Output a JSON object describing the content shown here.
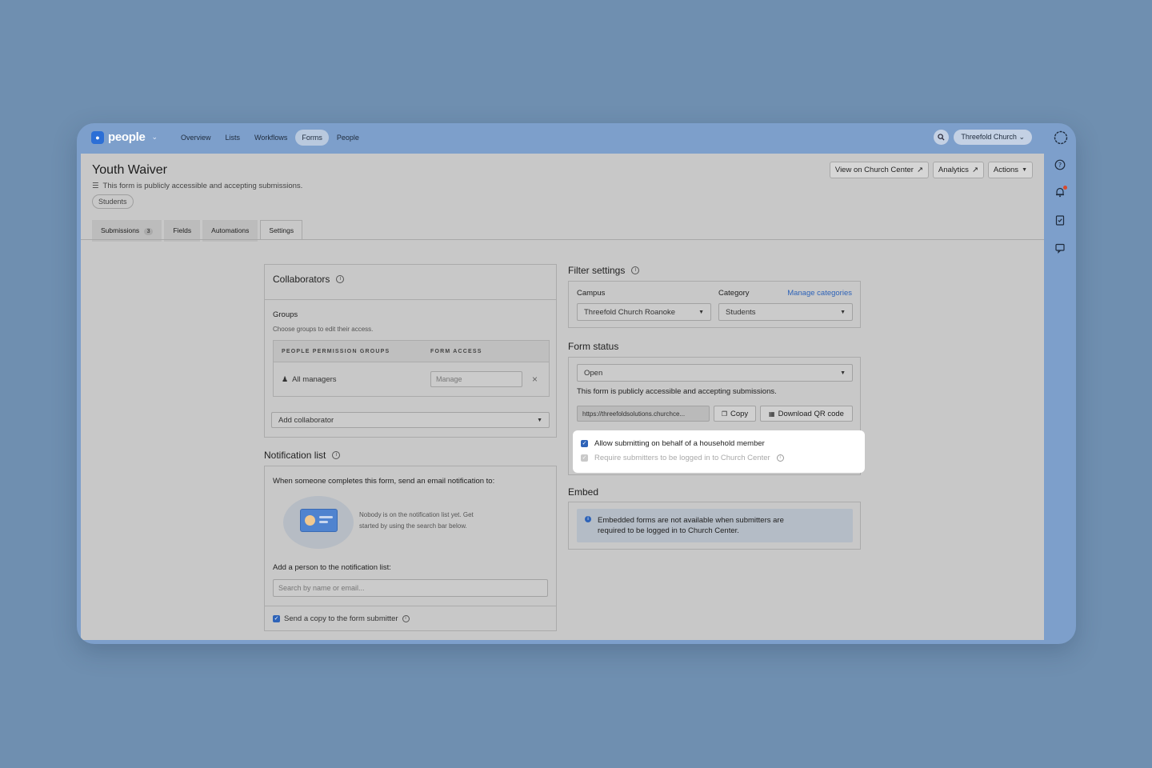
{
  "app": {
    "name": "people"
  },
  "nav": [
    "Overview",
    "Lists",
    "Workflows",
    "Forms",
    "People"
  ],
  "org_button": "Threefold Church",
  "page": {
    "title": "Youth Waiver",
    "subtitle": "This form is publicly accessible and accepting submissions.",
    "tag": "Students"
  },
  "header_actions": {
    "view": "View on Church Center",
    "analytics": "Analytics",
    "actions": "Actions"
  },
  "tabs": {
    "submissions": "Submissions",
    "submissions_count": "3",
    "fields": "Fields",
    "automations": "Automations",
    "settings": "Settings"
  },
  "collaborators": {
    "title": "Collaborators",
    "groups_label": "Groups",
    "groups_hint": "Choose groups to edit their access.",
    "col_groups": "PEOPLE PERMISSION GROUPS",
    "col_access": "FORM ACCESS",
    "row_name": "All managers",
    "row_access_placeholder": "Manage",
    "add_placeholder": "Add collaborator"
  },
  "notification": {
    "title": "Notification list",
    "intro": "When someone completes this form, send an email notification to:",
    "empty_line1": "Nobody is on the notification list yet. Get",
    "empty_line2": "started by using the search bar below.",
    "add_label": "Add a person to the notification list:",
    "search_placeholder": "Search by name or email...",
    "copy_label": "Send a copy to the form submitter"
  },
  "filter": {
    "title": "Filter settings",
    "campus_label": "Campus",
    "campus_value": "Threefold Church Roanoke",
    "category_label": "Category",
    "manage_link": "Manage categories",
    "category_value": "Students"
  },
  "form_status": {
    "title": "Form status",
    "status_value": "Open",
    "description": "This form is publicly accessible and accepting submissions.",
    "url": "https://threefoldsolutions.churchce...",
    "copy": "Copy",
    "qr": "Download QR code",
    "allow_household": "Allow submitting on behalf of a household member",
    "require_login": "Require submitters to be logged in to Church Center"
  },
  "embed": {
    "title": "Embed",
    "notice_line1": "Embedded forms are not available when submitters are",
    "notice_line2": "required to be logged in to Church Center."
  },
  "colors": {
    "background": "#6f8fb0",
    "window": "#7d9fcb",
    "accent": "#2e63b8",
    "notification_dot": "#d9492c"
  },
  "icons": [
    "search-icon",
    "chevron-down-icon",
    "external-link-icon",
    "trend-icon",
    "help-icon",
    "bell-icon",
    "clipboard-icon",
    "chat-icon",
    "profile-ring-icon",
    "info-icon",
    "people-icon",
    "close-icon",
    "copy-icon",
    "qr-icon",
    "check-icon"
  ]
}
